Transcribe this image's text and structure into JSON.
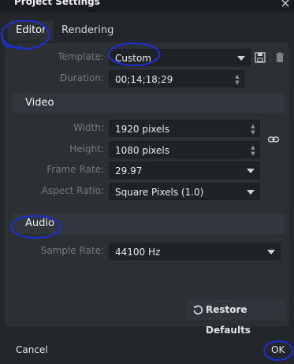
{
  "window": {
    "title": "Project Settings"
  },
  "tabs": [
    {
      "label": "Editor",
      "active": true
    },
    {
      "label": "Rendering",
      "active": false
    }
  ],
  "editor": {
    "template": {
      "label": "Template:",
      "value": "Custom"
    },
    "duration": {
      "label": "Duration:",
      "value": "00;14;18;29"
    }
  },
  "video": {
    "section_label": "Video",
    "width": {
      "label": "Width:",
      "value": "1920 pixels"
    },
    "height": {
      "label": "Height:",
      "value": "1080 pixels"
    },
    "frame_rate": {
      "label": "Frame Rate:",
      "value": "29.97"
    },
    "aspect_ratio": {
      "label": "Aspect Ratio:",
      "value": "Square Pixels (1.0)"
    }
  },
  "audio": {
    "section_label": "Audio",
    "sample_rate": {
      "label": "Sample Rate:",
      "value": "44100 Hz"
    }
  },
  "buttons": {
    "restore_defaults": "Restore Defaults",
    "cancel": "Cancel",
    "ok": "OK"
  },
  "icons": {
    "save": "save-icon",
    "delete": "trash-icon",
    "link": "link-icon",
    "restore": "restore-icon",
    "close": "close-icon"
  },
  "colors": {
    "background": "#23272b",
    "panel": "#2b3035",
    "section": "#31373d",
    "field": "#1f2327",
    "annotation_ink": "#1b2fd6"
  }
}
